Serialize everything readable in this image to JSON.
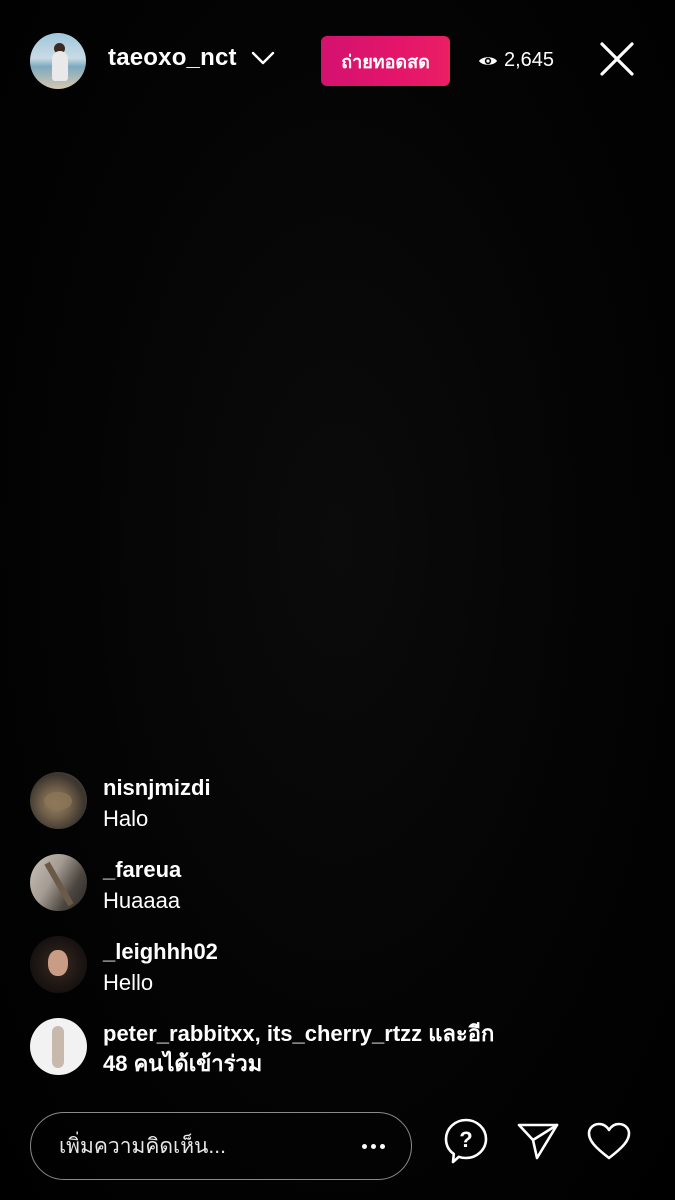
{
  "header": {
    "host_username": "taeoxo_nct",
    "live_label": "ถ่ายทอดสด",
    "viewer_count": "2,645",
    "icons": {
      "dropdown": "chevron-down-icon",
      "viewers": "eye-icon",
      "close": "close-icon"
    }
  },
  "comments": [
    {
      "username": "nisnjmizdi",
      "message": "Halo"
    },
    {
      "username": "_fareua",
      "message": "Huaaaa"
    },
    {
      "username": "_leighhh02",
      "message": "Hello"
    }
  ],
  "join_notice": {
    "line1": "peter_rabbitxx, its_cherry_rtzz และอีก",
    "line2": "48 คนได้เข้าร่วม"
  },
  "bottom_bar": {
    "comment_placeholder": "เพิ่มความคิดเห็น...",
    "icons": {
      "more": "more-horizontal-icon",
      "question": "question-bubble-icon",
      "share": "paper-plane-icon",
      "like": "heart-icon"
    }
  },
  "colors": {
    "background": "#000000",
    "live_badge": "#e4156a",
    "text": "#ffffff",
    "input_border": "#8a8a8a"
  }
}
